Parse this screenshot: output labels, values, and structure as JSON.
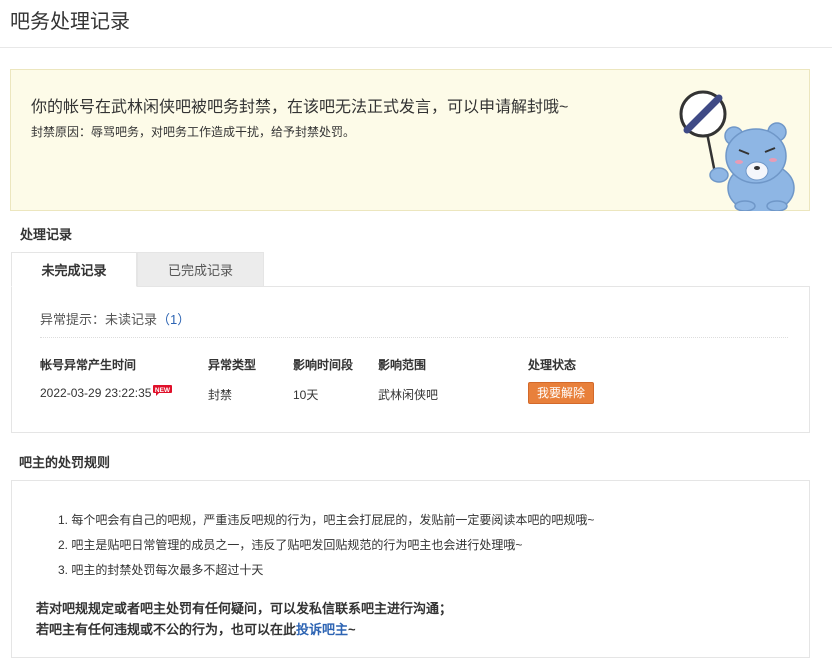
{
  "page": {
    "title": "吧务处理记录"
  },
  "notice": {
    "main": "你的帐号在武林闲侠吧被吧务封禁，在该吧无法正式发言，可以申请解封哦~",
    "reason": "封禁原因：辱骂吧务，对吧务工作造成干扰，给予封禁处罚。"
  },
  "records": {
    "section_title": "处理记录",
    "tabs": [
      {
        "label": "未完成记录",
        "active": true
      },
      {
        "label": "已完成记录",
        "active": false
      }
    ],
    "alert_prefix": "异常提示：未读记录",
    "alert_count": "（1）",
    "columns": [
      "帐号异常产生时间",
      "异常类型",
      "影响时间段",
      "影响范围",
      "处理状态"
    ],
    "rows": [
      {
        "time": "2022-03-29 23:22:35",
        "badge": "NEW",
        "type": "封禁",
        "duration": "10天",
        "scope": "武林闲侠吧",
        "action": "我要解除"
      }
    ]
  },
  "rules": {
    "section_title": "吧主的处罚规则",
    "items": [
      "1. 每个吧会有自己的吧规，严重违反吧规的行为，吧主会打屁屁的，发贴前一定要阅读本吧的吧规哦~",
      "2. 吧主是贴吧日常管理的成员之一，违反了贴吧发回贴规范的行为吧主也会进行处理哦~",
      "3. 吧主的封禁处罚每次最多不超过十天"
    ],
    "note1": "若对吧规规定或者吧主处罚有任何疑问，可以发私信联系吧主进行沟通；",
    "note2_prefix": "若吧主有任何违规或不公的行为，也可以在此",
    "note2_link": "投诉吧主",
    "note2_suffix": "~"
  },
  "colors": {
    "accent_orange": "#e8803b",
    "link_blue": "#2d64b3",
    "notice_bg": "#fdfbe8",
    "badge_red": "#e0102a"
  }
}
